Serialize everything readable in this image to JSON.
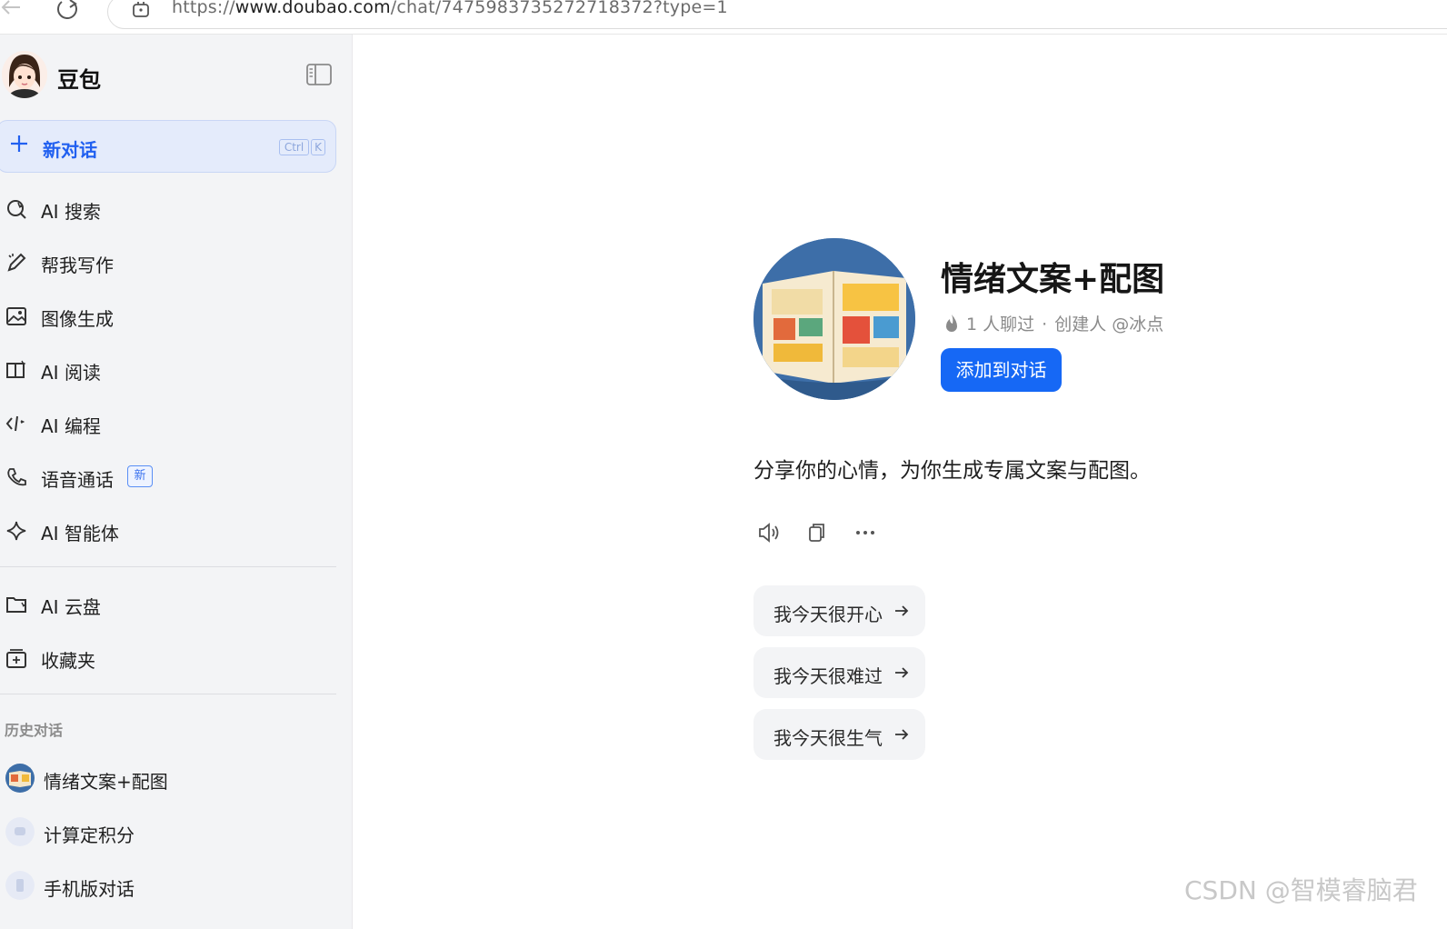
{
  "browser": {
    "url_prefix": "https://",
    "url_domain": "www.doubao.com",
    "url_path": "/chat/7475983735272718372?type=1"
  },
  "sidebar": {
    "brand": "豆包",
    "new_chat": {
      "label": "新对话",
      "shortcut_ctrl": "Ctrl",
      "shortcut_key": "K"
    },
    "items": [
      {
        "label": "AI 搜索",
        "icon": "search-icon"
      },
      {
        "label": "帮我写作",
        "icon": "pen-icon"
      },
      {
        "label": "图像生成",
        "icon": "image-icon"
      },
      {
        "label": "AI 阅读",
        "icon": "book-icon"
      },
      {
        "label": "AI 编程",
        "icon": "code-icon"
      },
      {
        "label": "语音通话",
        "icon": "phone-icon",
        "badge": "新"
      },
      {
        "label": "AI 智能体",
        "icon": "sparkle-icon"
      }
    ],
    "items2": [
      {
        "label": "AI 云盘",
        "icon": "folder-icon"
      },
      {
        "label": "收藏夹",
        "icon": "bookmark-icon"
      }
    ],
    "history_title": "历史对话",
    "history": [
      {
        "label": "情绪文案+配图"
      },
      {
        "label": "计算定积分"
      },
      {
        "label": "手机版对话"
      }
    ]
  },
  "bot": {
    "name": "情绪文案+配图",
    "chat_count": "1 人聊过",
    "separator": "·",
    "creator": "创建人 @冰点",
    "add_button": "添加到对话",
    "greeting": "分享你的心情，为你生成专属文案与配图。",
    "suggestions": [
      "我今天很开心",
      "我今天很难过",
      "我今天很生气"
    ]
  },
  "watermark": "CSDN @智模睿脑君",
  "colors": {
    "accent": "#1668f5",
    "sidebar_bg": "#f3f4f6",
    "new_chat_bg": "#e4ebfb"
  }
}
